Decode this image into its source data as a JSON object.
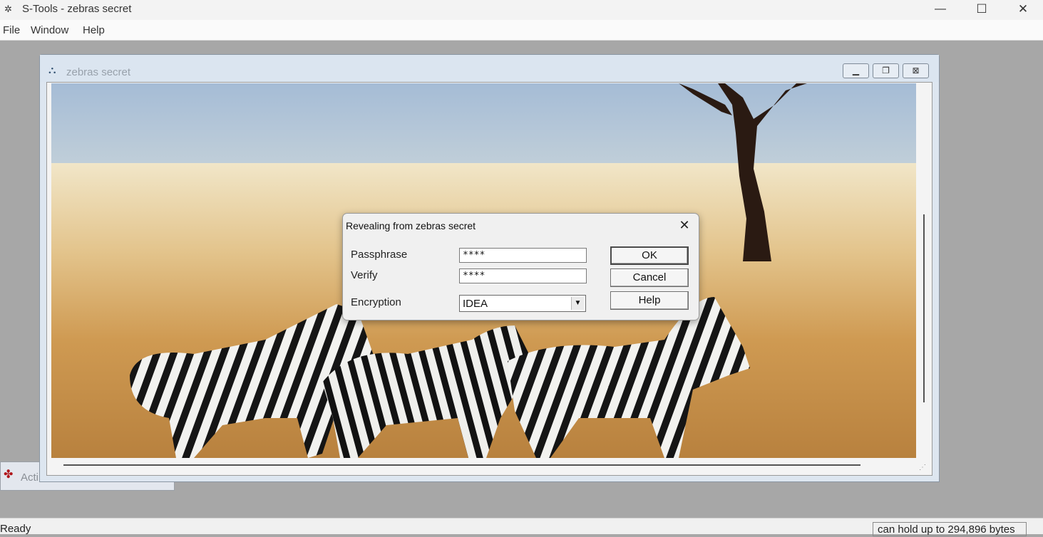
{
  "app": {
    "title": "S-Tools - zebras secret",
    "icon": "s-tools-app-icon",
    "window_controls": {
      "minimize": "—",
      "maximize": "☐",
      "close": "✕"
    }
  },
  "menubar": {
    "items": [
      "File",
      "Window",
      "Help"
    ]
  },
  "minimized_window": {
    "label": "Acti",
    "icon": "action-window-icon"
  },
  "child_window": {
    "title": "zebras secret",
    "icon": "picture-icon",
    "controls": {
      "minimize": "▁",
      "restore": "❐",
      "close": "⊠"
    },
    "image_description_icon": "zebra-photo"
  },
  "dialog": {
    "title": "Revealing from zebras secret",
    "close": "✕",
    "fields": {
      "passphrase_label": "Passphrase",
      "passphrase_value": "****",
      "verify_label": "Verify",
      "verify_value": "****",
      "encryption_label": "Encryption",
      "encryption_value": "IDEA"
    },
    "buttons": {
      "ok": "OK",
      "cancel": "Cancel",
      "help": "Help"
    }
  },
  "statusbar": {
    "text": "Ready",
    "capacity": "can hold up to 294,896 bytes"
  }
}
